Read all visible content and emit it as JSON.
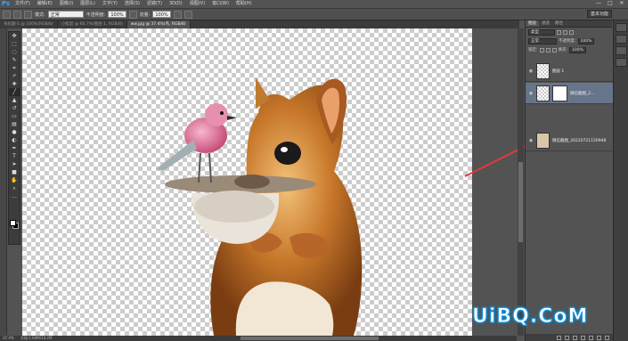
{
  "app": {
    "logo": "Ps"
  },
  "menubar": {
    "items": [
      "文件(F)",
      "编辑(E)",
      "图像(I)",
      "图层(L)",
      "文字(Y)",
      "选择(S)",
      "滤镜(T)",
      "3D(D)",
      "视图(V)",
      "窗口(W)",
      "帮助(H)"
    ],
    "minimize": "—",
    "maximize": "□",
    "close": "✕"
  },
  "options": {
    "mode_label": "模式:",
    "mode_value": "正常",
    "opacity_label": "不透明度:",
    "opacity_value": "100%",
    "flow_label": "流量:",
    "flow_value": "100%",
    "workspace": "基本功能"
  },
  "tabs": [
    {
      "label": "未标题-1 @ 100%(RGB/8)",
      "active": false
    },
    {
      "label": "小松鼠 @ 66.7%(图层 1, RGB/8)",
      "active": false
    },
    {
      "label": "ww.jpg @ 37.4%(鸟, RGB/8)",
      "active": true
    }
  ],
  "tools": [
    "move",
    "marquee",
    "lasso",
    "quick-select",
    "crop",
    "eyedropper",
    "heal",
    "brush",
    "stamp",
    "history-brush",
    "eraser",
    "gradient",
    "blur",
    "dodge",
    "pen",
    "type",
    "path-select",
    "shape",
    "hand",
    "zoom",
    "more"
  ],
  "status": {
    "zoom": "37.4%",
    "doc": "文档:1.84M/10.2M"
  },
  "layers_panel": {
    "tabs": [
      {
        "label": "图层",
        "active": true
      },
      {
        "label": "通道",
        "active": false
      },
      {
        "label": "路径",
        "active": false
      }
    ],
    "filter_label": "类型",
    "blend_mode": "正常",
    "opacity_label": "不透明度:",
    "opacity_value": "100%",
    "lock_label": "锁定:",
    "fill_label": "填充:",
    "fill_value": "100%",
    "layers": [
      {
        "name": "图层 1",
        "selected": false,
        "has_mask": false
      },
      {
        "name": "微信截图_2...",
        "selected": true,
        "has_mask": true
      },
      {
        "name": "微信截图_20220721150948",
        "selected": false,
        "has_mask": false
      }
    ]
  },
  "watermark": {
    "text": "UiBQ.CoM"
  },
  "colors": {
    "accent": "#31a8ff",
    "arrow": "#e53935",
    "selected_layer": "#67758a"
  }
}
